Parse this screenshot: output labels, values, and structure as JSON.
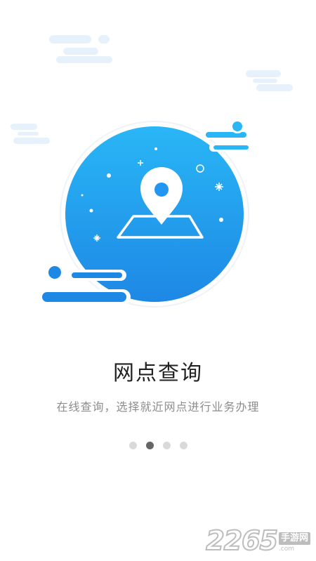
{
  "onboarding": {
    "title": "网点查询",
    "subtitle": "在线查询，选择就近网点进行业务办理",
    "page_indicator": {
      "total": 4,
      "active_index": 1
    }
  },
  "illustration": {
    "icon": "map-pin-on-map-icon",
    "colors": {
      "primary": "#2196f3",
      "light": "#29b6f6",
      "cloud": "#e6f1fb"
    }
  },
  "watermark": {
    "number": "2265",
    "site": "手游网",
    "domain": ".com"
  }
}
